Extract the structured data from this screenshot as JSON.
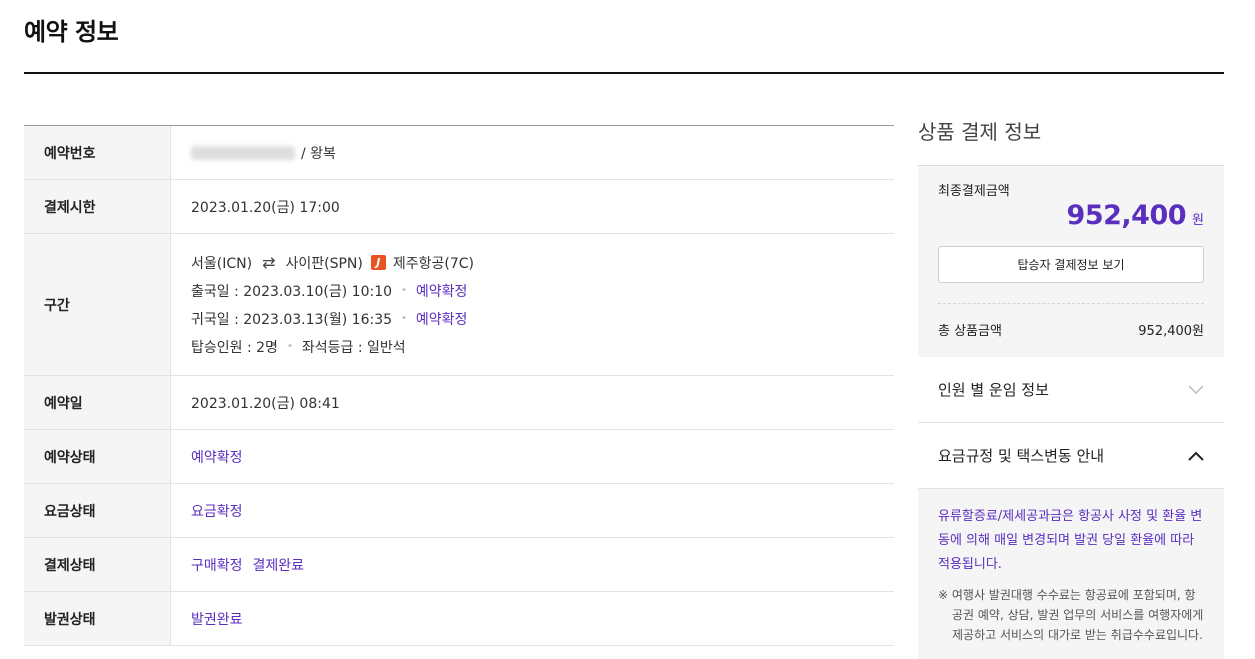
{
  "page": {
    "title": "예약 정보"
  },
  "reservation": {
    "rows": {
      "number": {
        "label": "예약번호",
        "trip_type": "/ 왕복"
      },
      "deadline": {
        "label": "결제시한",
        "value": "2023.01.20(금) 17:00"
      },
      "route": {
        "label": "구간",
        "origin": "서울(ICN)",
        "destination": "사이판(SPN)",
        "airline_logo_letter": "J",
        "airline": "제주항공(7C)",
        "depart_label": "출국일 : 2023.03.10(금) 10:10",
        "depart_status": "예약확정",
        "return_label": "귀국일 : 2023.03.13(월) 16:35",
        "return_status": "예약확정",
        "passengers": "탑승인원 : 2명",
        "seat_class": "좌석등급 : 일반석"
      },
      "booked_date": {
        "label": "예약일",
        "value": "2023.01.20(금) 08:41"
      },
      "reservation_status": {
        "label": "예약상태",
        "value": "예약확정"
      },
      "fare_status": {
        "label": "요금상태",
        "value": "요금확정"
      },
      "payment_status": {
        "label": "결제상태",
        "value1": "구매확정",
        "value2": "결제완료"
      },
      "ticket_status": {
        "label": "발권상태",
        "value": "발권완료"
      }
    }
  },
  "payment": {
    "title": "상품 결제 정보",
    "final_label": "최종결제금액",
    "final_amount": "952,400",
    "final_unit": "원",
    "detail_button": "탑승자 결제정보 보기",
    "total_label": "총 상품금액",
    "total_value": "952,400원"
  },
  "accordions": {
    "fare_by_person": "인원 별 운임 정보",
    "fare_rules": "요금규정 및 택스변동 안내"
  },
  "notice": {
    "main": "유류할증료/제세공과금은 항공사 사정 및 환율 변동에 의해 매일 변경되며 발권 당일 환율에 따라 적용됩니다.",
    "sub": "※ 여행사 발권대행 수수료는 항공료에 포함되며, 항공권 예약, 상담, 발권 업무의 서비스를 여행자에게 제공하고 서비스의 대가로 받는 취급수수료입니다."
  },
  "colors": {
    "accent": "#5a2fbf",
    "airline": "#e8531f"
  },
  "icons": [
    "swap-arrows-icon",
    "airline-logo-icon",
    "chevron-down-icon",
    "chevron-up-icon"
  ]
}
